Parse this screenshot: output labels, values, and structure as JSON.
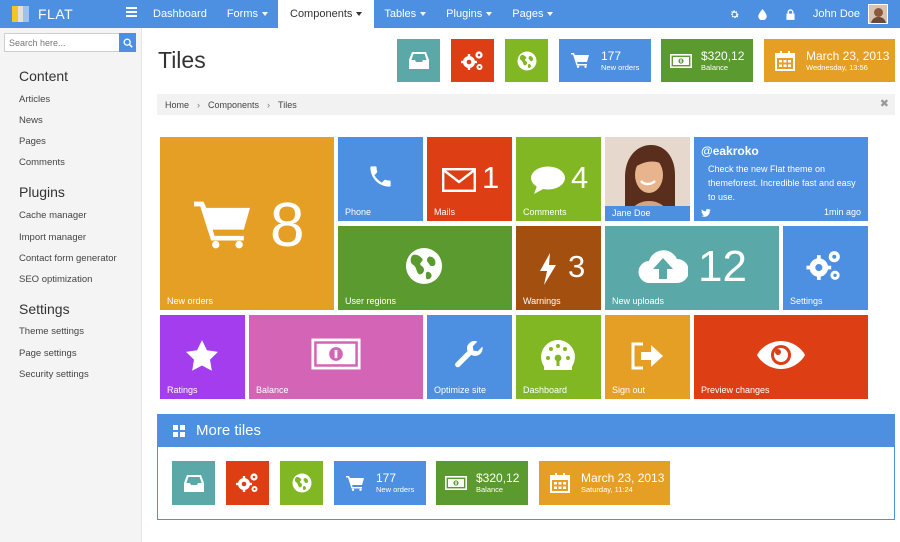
{
  "brand": {
    "name": "FLAT"
  },
  "nav": {
    "items": [
      {
        "label": "Dashboard"
      },
      {
        "label": "Forms"
      },
      {
        "label": "Components"
      },
      {
        "label": "Tables"
      },
      {
        "label": "Plugins"
      },
      {
        "label": "Pages"
      }
    ],
    "active": "Components",
    "user": "John Doe",
    "right_icons": [
      "gear-icon",
      "drop-icon",
      "lock-icon"
    ]
  },
  "search": {
    "placeholder": "Search here..."
  },
  "sidebar": {
    "sections": [
      {
        "heading": "Content",
        "items": [
          "Articles",
          "News",
          "Pages",
          "Comments"
        ]
      },
      {
        "heading": "Plugins",
        "items": [
          "Cache manager",
          "Import manager",
          "Contact form generator",
          "SEO optimization"
        ]
      },
      {
        "heading": "Settings",
        "items": [
          "Theme settings",
          "Page settings",
          "Security settings"
        ]
      }
    ]
  },
  "page": {
    "title": "Tiles"
  },
  "stats": {
    "orders": {
      "value": "177",
      "label": "New orders"
    },
    "balance": {
      "value": "$320,12",
      "label": "Balance"
    },
    "date": {
      "value": "March 23, 2013",
      "label": "Wednesday, 13:56"
    }
  },
  "breadcrumb": [
    "Home",
    "Components",
    "Tiles"
  ],
  "tiles": {
    "new_orders": {
      "label": "New orders",
      "count": "8"
    },
    "phone": {
      "label": "Phone"
    },
    "mails": {
      "label": "Mails",
      "count": "1"
    },
    "comments": {
      "label": "Comments",
      "count": "4"
    },
    "profile": {
      "name": "Jane Doe"
    },
    "tweet": {
      "handle": "@eakroko",
      "text": "Check the new Flat theme on themeforest. Incredible fast and easy to use.",
      "time": "1min ago"
    },
    "user_regions": {
      "label": "User regions"
    },
    "warnings": {
      "label": "Warnings",
      "count": "3"
    },
    "new_uploads": {
      "label": "New uploads",
      "count": "12"
    },
    "settings": {
      "label": "Settings"
    },
    "ratings": {
      "label": "Ratings"
    },
    "balance": {
      "label": "Balance"
    },
    "optimize": {
      "label": "Optimize site"
    },
    "dashboard": {
      "label": "Dashboard"
    },
    "sign_out": {
      "label": "Sign out"
    },
    "preview": {
      "label": "Preview changes"
    }
  },
  "more_tiles": {
    "title": "More tiles",
    "orders": {
      "value": "177",
      "label": "New orders"
    },
    "balance": {
      "value": "$320,12",
      "label": "Balance"
    },
    "date": {
      "value": "March 23, 2013",
      "label": "Saturday, 11:24"
    }
  },
  "colors": {
    "blue": "#4d8fe0",
    "teal": "#5aa9a8",
    "red": "#dd3e13",
    "lime": "#80b722",
    "green": "#5b9a2e",
    "orange": "#e69f25",
    "brown": "#a34f10",
    "purple": "#a33dee",
    "pink": "#d464b6"
  }
}
